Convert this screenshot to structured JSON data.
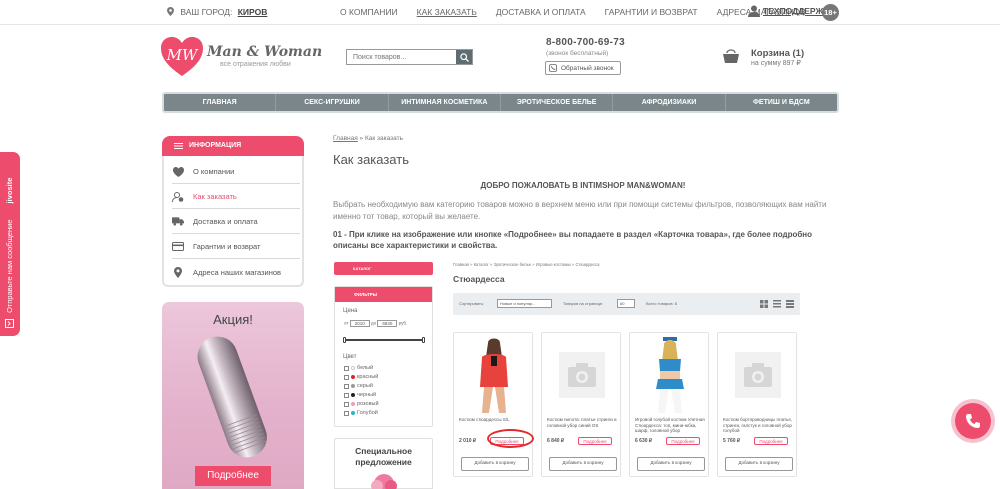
{
  "topbar": {
    "city_label": "ВАШ ГОРОД:",
    "city_value": "КИРОВ",
    "nav": [
      "О КОМПАНИИ",
      "КАК ЗАКАЗАТЬ",
      "ДОСТАВКА И ОПЛАТА",
      "ГАРАНТИИ И ВОЗВРАТ",
      "АДРЕСА МАГАЗИНОВ"
    ],
    "support_label": "ТЕХПОДДЕРЖКА",
    "age_badge": "18+"
  },
  "header": {
    "logo_name": "Man & Woman",
    "logo_tagline": "все отражения любви",
    "logo_monogram": "MW",
    "search_placeholder": "Поиск товаров...",
    "phone": "8-800-700-69-73",
    "phone_note": "(звонок бесплатный)",
    "callback_label": "Обратный звонок",
    "cart_title": "Корзина (1)",
    "cart_sum": "на сумму 897 ₽"
  },
  "mainnav": [
    "ГЛАВНАЯ",
    "СЕКС-ИГРУШКИ",
    "ИНТИМНАЯ КОСМЕТИКА",
    "ЭРОТИЧЕСКОЕ БЕЛЬЕ",
    "АФРОДИЗИАКИ",
    "ФЕТИШ И БДСМ"
  ],
  "sidebar": {
    "header": "ИНФОРМАЦИЯ",
    "items": [
      {
        "label": "О компании",
        "icon": "heart-icon"
      },
      {
        "label": "Как заказать",
        "icon": "user-icon"
      },
      {
        "label": "Доставка и оплата",
        "icon": "truck-icon"
      },
      {
        "label": "Гарантии и возврат",
        "icon": "card-icon"
      },
      {
        "label": "Адреса наших магазинов",
        "icon": "pin-icon"
      }
    ],
    "promo_title": "Акция!",
    "promo_button": "Подробнее"
  },
  "content": {
    "breadcrumb_home": "Главная",
    "breadcrumb_sep": " » ",
    "breadcrumb_current": "Как заказать",
    "title": "Как заказать",
    "welcome": "ДОБРО ПОЖАЛОВАТЬ В INTIMSHOP MAN&WOMAN!",
    "intro": "Выбрать необходимую вам категорию товаров можно в верхнем меню или при помощи системы фильтров, позволяющих вам найти именно тот товар, который вы желаете.",
    "step1": "01 - При клике на изображение или кнопке «Подробнее» вы попадаете в раздел «Карточка товара», где более подробно описаны все характеристики и свойства."
  },
  "mini": {
    "catalog": "КАТАЛОГ",
    "filters": "ФИЛЬТРЫ",
    "price_label": "Цена",
    "price_from": "от",
    "price_min": "2010",
    "price_to": "до",
    "price_max": "6840",
    "currency": "руб.",
    "color_label": "Цвет",
    "colors": [
      {
        "name": "белый",
        "color": "#ffffff"
      },
      {
        "name": "красный",
        "color": "#d9262c"
      },
      {
        "name": "серый",
        "color": "#9a9a9a"
      },
      {
        "name": "черный",
        "color": "#222222"
      },
      {
        "name": "розовый",
        "color": "#f29ab6"
      },
      {
        "name": "Голубой",
        "color": "#2bb3c9"
      }
    ],
    "special": "Специальное предложение",
    "breadcrumbs": "Главная » Каталог » Эротическое белье » Игровые костюмы » Стюардесса",
    "title": "Стюардесса",
    "sort_label": "Сортировать:",
    "sort_value": "Новые и популяр...",
    "per_page_label": "Товаров на странице:",
    "per_page_value": "60",
    "total": "Всего товаров: 8",
    "products": [
      {
        "name": "Костюм стюардессы S/L",
        "price": "2 010 ₽",
        "more": "Подробнее",
        "add": "Добавить в корзину",
        "image": "photo"
      },
      {
        "name": "Костюм пилота: платье стринги и головной убор синий OS",
        "price": "6 840 ₽",
        "more": "Подробнее",
        "add": "Добавить в корзину",
        "image": "camera-icon"
      },
      {
        "name": "Игровой голубой костюм Улетная Стюардесса: топ, мини-юбка, шарф, головной убор",
        "price": "6 630 ₽",
        "more": "Подробнее",
        "add": "Добавить в корзину",
        "image": "photo"
      },
      {
        "name": "Костюм бортпроводницы платье, стринги, галстук и головной убор голубой",
        "price": "5 760 ₽",
        "more": "Подробнее",
        "add": "Добавить в корзину",
        "image": "camera-icon"
      }
    ]
  },
  "feedback": {
    "label": "Отправьте нам сообщение",
    "brand": "jivosite"
  },
  "colors": {
    "accent": "#ee4c6d",
    "nav_bg": "#7a868a",
    "highlight": "#e42a2a"
  }
}
